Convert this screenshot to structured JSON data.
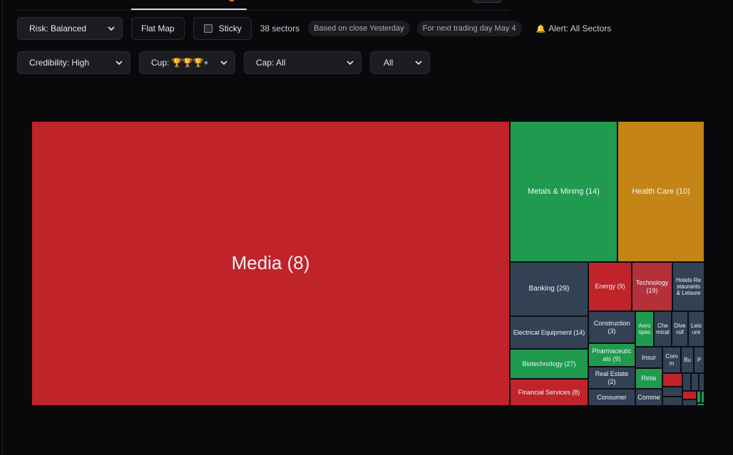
{
  "filters": {
    "risk": "Risk: Balanced",
    "flat_map": "Flat Map",
    "sticky": "Sticky",
    "sectors_count": "38 sectors",
    "based_on": "Based on close Yesterday",
    "next_day": "For next trading day May 4",
    "alert": "Alert: All Sectors",
    "credibility": "Credibility: High",
    "cup": "Cup: 🏆🏆🏆+",
    "cap": "Cap: All",
    "extra": "All"
  },
  "icons": {
    "bell": "bell-icon",
    "chevron": "chevron-down-icon",
    "checkbox": "checkbox-icon"
  },
  "colors": {
    "down": "#c0232a",
    "up": "#1f9a4f",
    "neutral": "#334155",
    "amber": "#c48416",
    "mild_down": "#b4313a"
  },
  "treemap": {
    "tiles": [
      {
        "label": "Media (8)"
      },
      {
        "label": "Metals & Mining (14)"
      },
      {
        "label": "Health Care (10)"
      },
      {
        "label": "Banking (29)"
      },
      {
        "label": "Energy (9)"
      },
      {
        "label": "Technology (19)"
      },
      {
        "label": "Hotels Restaurants & Leisure"
      },
      {
        "label": "Electrical Equipment (14)"
      },
      {
        "label": "Construction (3)"
      },
      {
        "label": "Aerospac"
      },
      {
        "label": "Chemical"
      },
      {
        "label": "Diversif"
      },
      {
        "label": "Leisure"
      },
      {
        "label": "Biotechnology (27)"
      },
      {
        "label": "Pharmaceuticals (9)"
      },
      {
        "label": "Insur"
      },
      {
        "label": "Comm"
      },
      {
        "label": "Bu"
      },
      {
        "label": "P"
      },
      {
        "label": "Real Estate (2)"
      },
      {
        "label": "Retai"
      },
      {
        "label": "Financial Services (8)"
      },
      {
        "label": "Consumer"
      },
      {
        "label": "Comme"
      }
    ]
  }
}
